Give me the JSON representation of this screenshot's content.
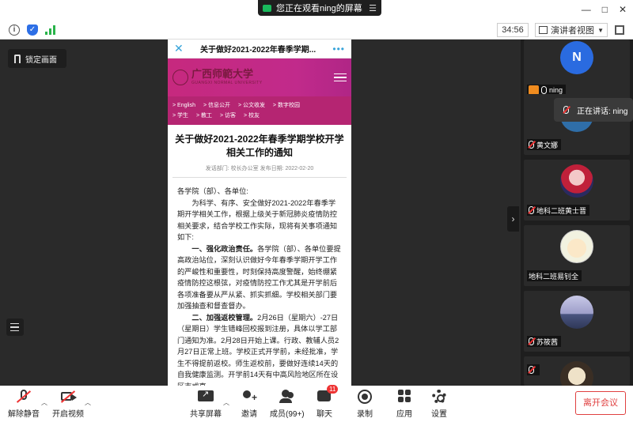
{
  "window": {
    "share_status": "您正在观看ning的屏幕",
    "minimize": "—",
    "maximize": "□",
    "close": "✕"
  },
  "toolbar": {
    "timer": "34:56",
    "view_mode": "演讲者视图"
  },
  "stage": {
    "lock_label": "锁定画面"
  },
  "phone": {
    "header_title": "关于做好2021-2022年春季学期...",
    "logo_cn": "广西师範大学",
    "logo_en": "GUANGXI NORMAL UNIVERSITY",
    "nav": [
      [
        "English",
        "信息公开",
        "公文收发",
        "数字校园"
      ],
      [
        "学生",
        "教工",
        "访客",
        "校友"
      ]
    ],
    "article_title": "关于做好2021-2022年春季学期学校开学相关工作的通知",
    "meta": "发话部门:  校长办公室   发布日期:   2022-02-20",
    "p1": "各学院（部）、各单位:",
    "p2": "为科学、有序、安全做好2021-2022年春季学期开学相关工作，根据上级关于新冠肺炎疫情防控相关要求，结合学校工作实际，现将有关事项通知如下:",
    "p3_head": "一、强化政治责任。",
    "p3": "各学院（部）、各单位要提高政治站位，深刻认识做好今年春季学期开学工作的严峻性和重要性，时刻保持高度警醒，始终绷紧疫情防控这根弦，对疫情防控工作尤其是开学前后各项准备要从严从紧、抓实抓细。学校相关部门要加强抽查和督查督办。",
    "p4_head": "二、加强返校管理。",
    "p4": "2月26日（星期六）-27日（星期日）学生错峰回校报到注册，具体以学工部门通知为准。2月28日开始上课。行政、教辅人员2月27日正常上班。学校正式开学前，未经批准，学生不得提前返校。师生返校前，要做好连续14天的自我健康监测。开学前14天有中高风险地区所在设区市或直"
  },
  "participants": [
    {
      "name": "ning",
      "initial": "N",
      "host": true
    },
    {
      "name": "黄文娜"
    },
    {
      "name": "地科二班黄士晋"
    },
    {
      "name": "地科二班易钊全"
    },
    {
      "name": "苏筱茜"
    },
    {
      "name": ""
    }
  ],
  "speaking_now": "正在讲话: ning",
  "bottom": {
    "unmute": "解除静音",
    "start_video": "开启视频",
    "share": "共享屏幕",
    "invite": "邀请",
    "members": "成员(99+)",
    "chat": "聊天",
    "chat_badge": "11",
    "record": "录制",
    "apps": "应用",
    "settings": "设置",
    "leave": "离开会议"
  },
  "colors": {
    "brand_magenta": "#c12a8b",
    "accent_blue": "#36a3d9",
    "leave_red": "#e04040",
    "signal_green": "#29b34a"
  }
}
